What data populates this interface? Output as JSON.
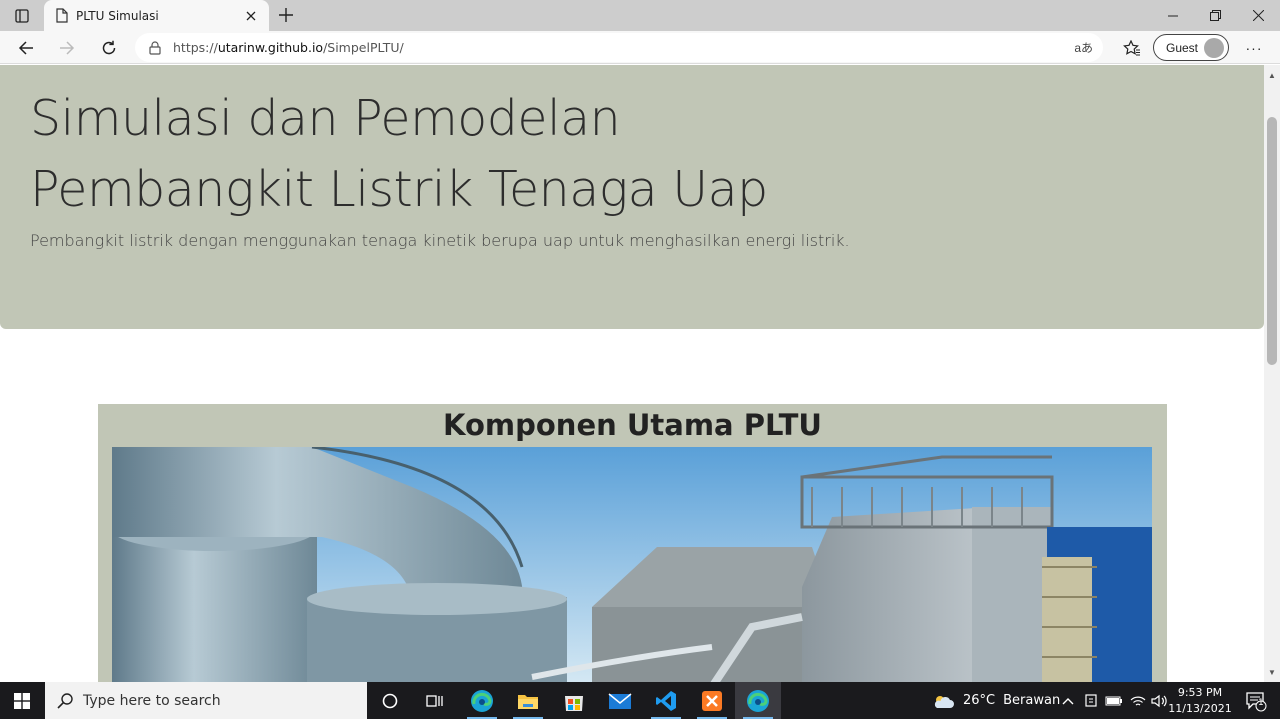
{
  "browser": {
    "tab_title": "PLTU Simulasi",
    "url_prefix": "https://",
    "url_domain": "utarinw.github.io",
    "url_path": "/SimpelPLTU/",
    "read_aloud_label": "aあ",
    "profile_label": "Guest",
    "more_label": "···"
  },
  "page": {
    "title_line1": "Simulasi dan Pemodelan",
    "title_line2": "Pembangkit Listrik Tenaga Uap",
    "subtitle": "Pembangkit listrik dengan menggunakan tenaga kinetik berupa uap untuk menghasilkan energi listrik.",
    "section_title": "Komponen Utama PLTU"
  },
  "taskbar": {
    "search_placeholder": "Type here to search",
    "weather_temp": "26°C",
    "weather_text": "Berawan",
    "time": "9:53 PM",
    "date": "11/13/2021",
    "notification_count": "1",
    "apps": [
      "task-view",
      "edge",
      "file-explorer",
      "microsoft-store",
      "mail",
      "vs-code",
      "xampp",
      "edge-active"
    ]
  },
  "colors": {
    "jumbotron_bg": "#c1c6b6",
    "taskbar_bg": "#1a1a1d",
    "tab_bar_bg": "#cdcdcd"
  }
}
